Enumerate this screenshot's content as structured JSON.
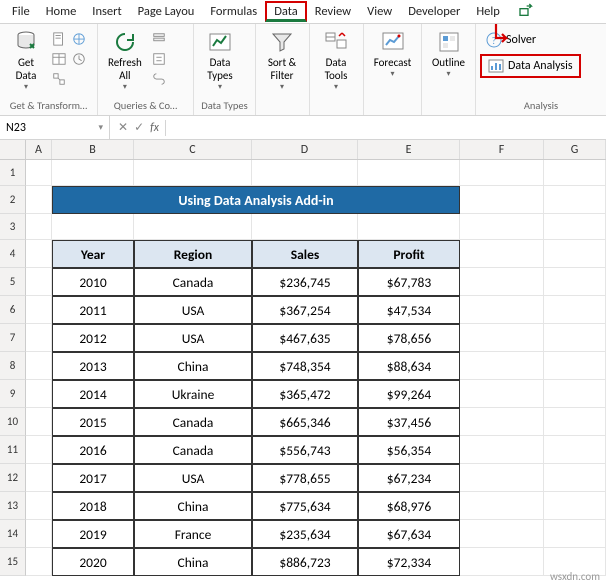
{
  "tabs": {
    "file": "File",
    "home": "Home",
    "insert": "Insert",
    "pagelayout": "Page Layou",
    "formulas": "Formulas",
    "data": "Data",
    "review": "Review",
    "view": "View",
    "developer": "Developer",
    "help": "Help"
  },
  "ribbon": {
    "get_data": "Get\nData",
    "group_get": "Get & Transform…",
    "refresh_all": "Refresh\nAll",
    "group_queries": "Queries & Co…",
    "data_types": "Data\nTypes",
    "group_types": "Data Types",
    "sort_filter": "Sort &\nFilter",
    "data_tools": "Data\nTools",
    "forecast": "Forecast",
    "outline": "Outline",
    "solver": "Solver",
    "data_analysis": "Data Analysis",
    "group_analysis": "Analysis"
  },
  "namebox": "N23",
  "fx": "fx",
  "columns": {
    "A": "A",
    "B": "B",
    "C": "C",
    "D": "D",
    "E": "E",
    "F": "F",
    "G": "G"
  },
  "title": "Using Data Analysis Add-in",
  "headers": {
    "year": "Year",
    "region": "Region",
    "sales": "Sales",
    "profit": "Profit"
  },
  "rows": [
    {
      "n": "5",
      "year": "2010",
      "region": "Canada",
      "sales": "$236,745",
      "profit": "$67,783"
    },
    {
      "n": "6",
      "year": "2011",
      "region": "USA",
      "sales": "$367,254",
      "profit": "$47,534"
    },
    {
      "n": "7",
      "year": "2012",
      "region": "USA",
      "sales": "$467,635",
      "profit": "$78,656"
    },
    {
      "n": "8",
      "year": "2013",
      "region": "China",
      "sales": "$748,354",
      "profit": "$88,634"
    },
    {
      "n": "9",
      "year": "2014",
      "region": "Ukraine",
      "sales": "$365,472",
      "profit": "$99,264"
    },
    {
      "n": "10",
      "year": "2015",
      "region": "Canada",
      "sales": "$665,346",
      "profit": "$37,456"
    },
    {
      "n": "11",
      "year": "2016",
      "region": "Canada",
      "sales": "$556,743",
      "profit": "$56,354"
    },
    {
      "n": "12",
      "year": "2017",
      "region": "USA",
      "sales": "$778,655",
      "profit": "$67,234"
    },
    {
      "n": "13",
      "year": "2018",
      "region": "China",
      "sales": "$775,634",
      "profit": "$68,976"
    },
    {
      "n": "14",
      "year": "2019",
      "region": "France",
      "sales": "$235,634",
      "profit": "$67,634"
    },
    {
      "n": "15",
      "year": "2020",
      "region": "China",
      "sales": "$886,723",
      "profit": "$72,334"
    }
  ],
  "rownums": {
    "r1": "1",
    "r2": "2",
    "r3": "3",
    "r4": "4"
  },
  "watermark": "wsxdn.com"
}
